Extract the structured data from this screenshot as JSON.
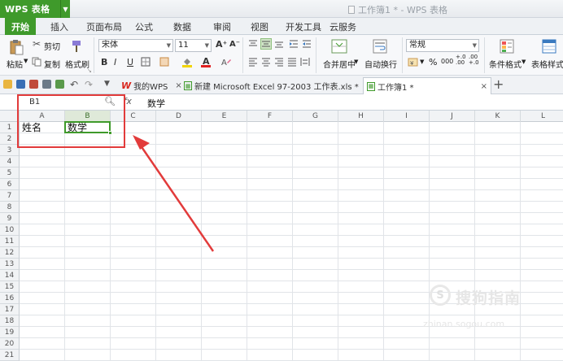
{
  "app": {
    "name": "WPS 表格",
    "window_title": "工作簿1 * - WPS 表格"
  },
  "menu": {
    "items": [
      "开始",
      "插入",
      "页面布局",
      "公式",
      "数据",
      "审阅",
      "视图",
      "开发工具",
      "云服务"
    ],
    "active": "开始"
  },
  "ribbon": {
    "paste_label": "粘贴",
    "cut_label": "剪切",
    "copy_label": "复制",
    "format_painter_label": "格式刷",
    "font_name": "宋体",
    "font_size": "11",
    "merge_label": "合并居中",
    "wrap_label": "自动换行",
    "number_format": "常规",
    "conditional_label": "条件格式",
    "table_style_label": "表格样式",
    "bold": "B",
    "italic": "I",
    "underline": "U",
    "percent": "%",
    "thousands": "000",
    "dec_inc": "+.0 .00",
    "dec_dec": ".00 +.0"
  },
  "tabs": {
    "items": [
      {
        "label": "我的WPS",
        "icon": "wps-logo-icon"
      },
      {
        "label": "新建 Microsoft Excel 97-2003 工作表.xls *",
        "icon": "sheet-icon"
      },
      {
        "label": "工作簿1 *",
        "icon": "sheet-icon",
        "active": true
      }
    ],
    "add_label": "+"
  },
  "formula": {
    "name_box": "B1",
    "content": "数学",
    "fx_label": "fx"
  },
  "sheet": {
    "columns": [
      "A",
      "B",
      "C",
      "D",
      "E",
      "F",
      "G",
      "H",
      "I",
      "J",
      "K",
      "L"
    ],
    "rows": [
      "1",
      "2",
      "3",
      "4",
      "5",
      "6",
      "7",
      "8",
      "9",
      "10",
      "11",
      "12",
      "13",
      "14",
      "15",
      "16",
      "17",
      "18",
      "19",
      "20",
      "21"
    ],
    "cells": {
      "A1": "姓名",
      "B1": "数学"
    },
    "selected_cell": "B1",
    "selected_column": "B",
    "accent_color": "#3f9a2b"
  },
  "annotation": {
    "color": "#e23b3b"
  },
  "watermark": {
    "logo": "S",
    "text": "搜狗指南",
    "url": "zhinan.sogou.com"
  }
}
